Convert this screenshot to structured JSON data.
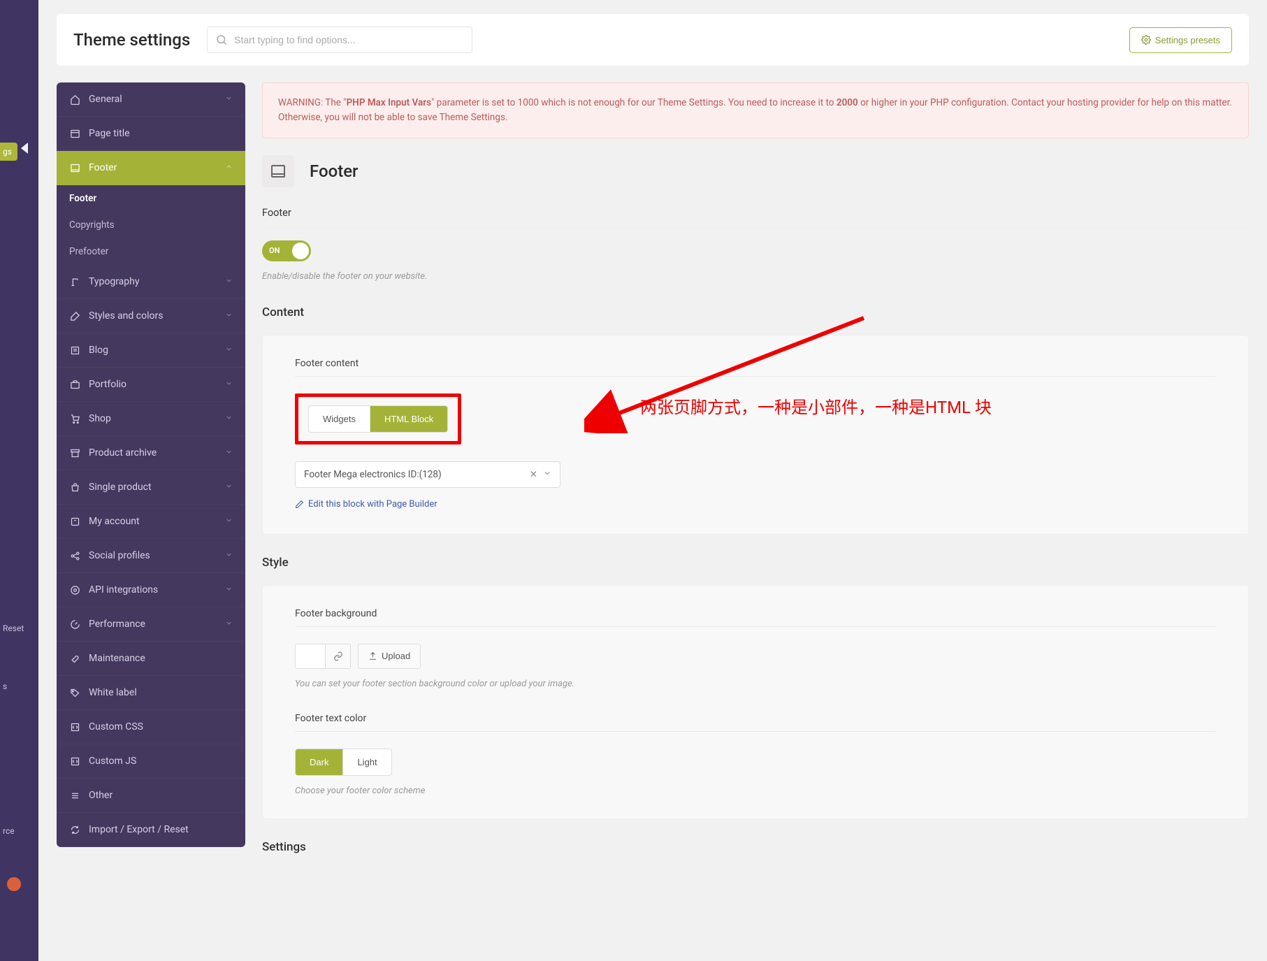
{
  "wp_sidebar": {
    "active_tab": "gs",
    "reset": "Reset",
    "rce": "rce",
    "s": "s"
  },
  "header": {
    "title": "Theme settings",
    "search_placeholder": "Start typing to find options...",
    "presets_label": "Settings presets"
  },
  "nav": {
    "general": "General",
    "page_title": "Page title",
    "footer": "Footer",
    "footer_sub": "Footer",
    "copyrights": "Copyrights",
    "prefooter": "Prefooter",
    "typography": "Typography",
    "styles": "Styles and colors",
    "blog": "Blog",
    "portfolio": "Portfolio",
    "shop": "Shop",
    "product_archive": "Product archive",
    "single_product": "Single product",
    "my_account": "My account",
    "social": "Social profiles",
    "api": "API integrations",
    "performance": "Performance",
    "maintenance": "Maintenance",
    "white_label": "White label",
    "custom_css": "Custom CSS",
    "custom_js": "Custom JS",
    "other": "Other",
    "import": "Import / Export / Reset"
  },
  "warning": {
    "prefix": "WARNING: The \"",
    "bold1": "PHP Max Input Vars",
    "mid1": "\" parameter is set to 1000 which is not enough for our Theme Settings. You need to increase it to ",
    "bold2": "2000",
    "suffix": " or higher in your PHP configuration. Contact your hosting provider for help on this matter. Otherwise, you will not be able to save Theme Settings."
  },
  "section": {
    "title": "Footer"
  },
  "footer_toggle": {
    "label": "Footer",
    "state": "ON",
    "hint": "Enable/disable the footer on your website."
  },
  "content": {
    "title": "Content",
    "footer_content_label": "Footer content",
    "widgets": "Widgets",
    "html_block": "HTML Block",
    "annotation": "两张页脚方式，一种是小部件，一种是HTML 块",
    "select_value": "Footer Mega electronics ID:(128)",
    "edit_link": "Edit this block with Page Builder"
  },
  "style": {
    "title": "Style",
    "bg_label": "Footer background",
    "upload": "Upload",
    "bg_hint": "You can set your footer section background color or upload your image.",
    "text_color_label": "Footer text color",
    "dark": "Dark",
    "light": "Light",
    "text_color_hint": "Choose your footer color scheme"
  },
  "settings": {
    "title": "Settings"
  }
}
